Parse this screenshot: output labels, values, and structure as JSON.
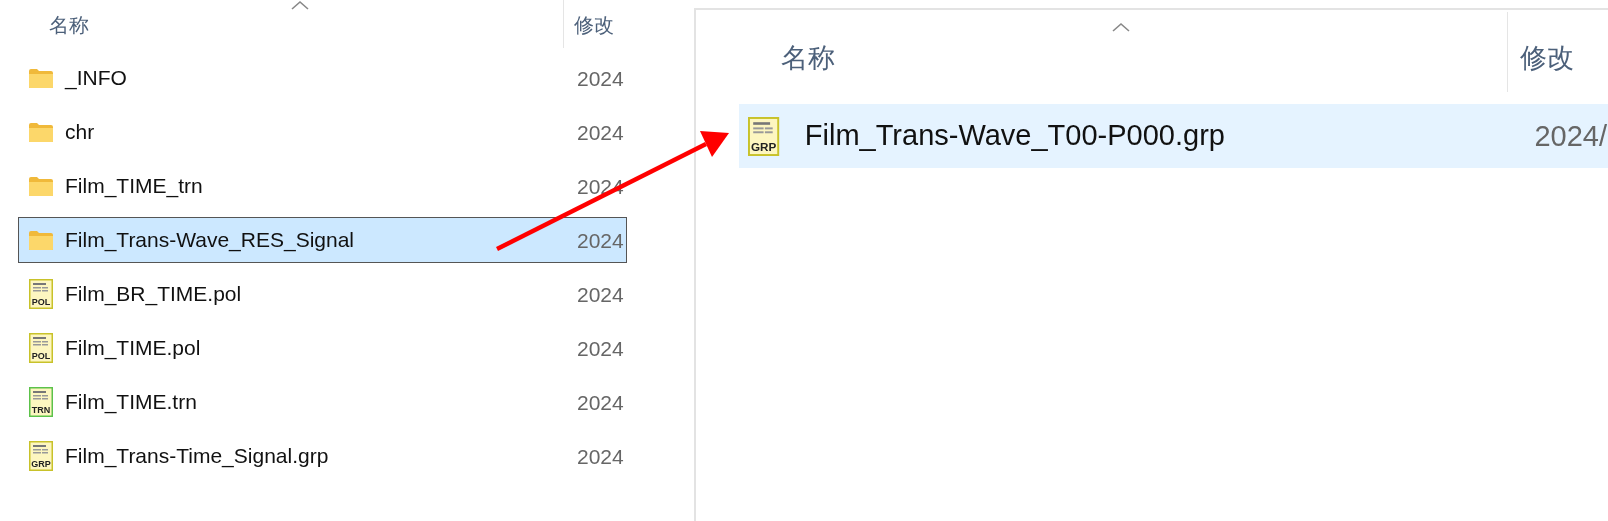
{
  "panels": [
    {
      "focused": true,
      "columns": [
        {
          "label": "名称",
          "sorted": true
        },
        {
          "label": "修改"
        }
      ],
      "rows": [
        {
          "kind": "folder",
          "name": "_INFO",
          "date": "2024",
          "selected": false
        },
        {
          "kind": "folder",
          "name": "chr",
          "date": "2024",
          "selected": false
        },
        {
          "kind": "folder",
          "name": "Film_TIME_trn",
          "date": "2024",
          "selected": false
        },
        {
          "kind": "folder",
          "name": "Film_Trans-Wave_RES_Signal",
          "date": "2024",
          "selected": true
        },
        {
          "kind": "file",
          "icon_label": "POL",
          "color": "#c8c22a",
          "name": "Film_BR_TIME.pol",
          "date": "2024",
          "selected": false
        },
        {
          "kind": "file",
          "icon_label": "POL",
          "color": "#c8c22a",
          "name": "Film_TIME.pol",
          "date": "2024",
          "selected": false
        },
        {
          "kind": "file",
          "icon_label": "TRN",
          "color": "#5cc24a",
          "name": "Film_TIME.trn",
          "date": "2024",
          "selected": false
        },
        {
          "kind": "file",
          "icon_label": "GRP",
          "color": "#c8c22a",
          "name": "Film_Trans-Time_Signal.grp",
          "date": "2024",
          "selected": false
        }
      ]
    },
    {
      "focused": false,
      "columns": [
        {
          "label": "名称",
          "sorted": true
        },
        {
          "label": "修改"
        }
      ],
      "rows": [
        {
          "kind": "file",
          "icon_label": "GRP",
          "color": "#c8c22a",
          "name": "Film_Trans-Wave_T00-P000.grp",
          "date": "2024/",
          "selected": true
        }
      ]
    }
  ]
}
